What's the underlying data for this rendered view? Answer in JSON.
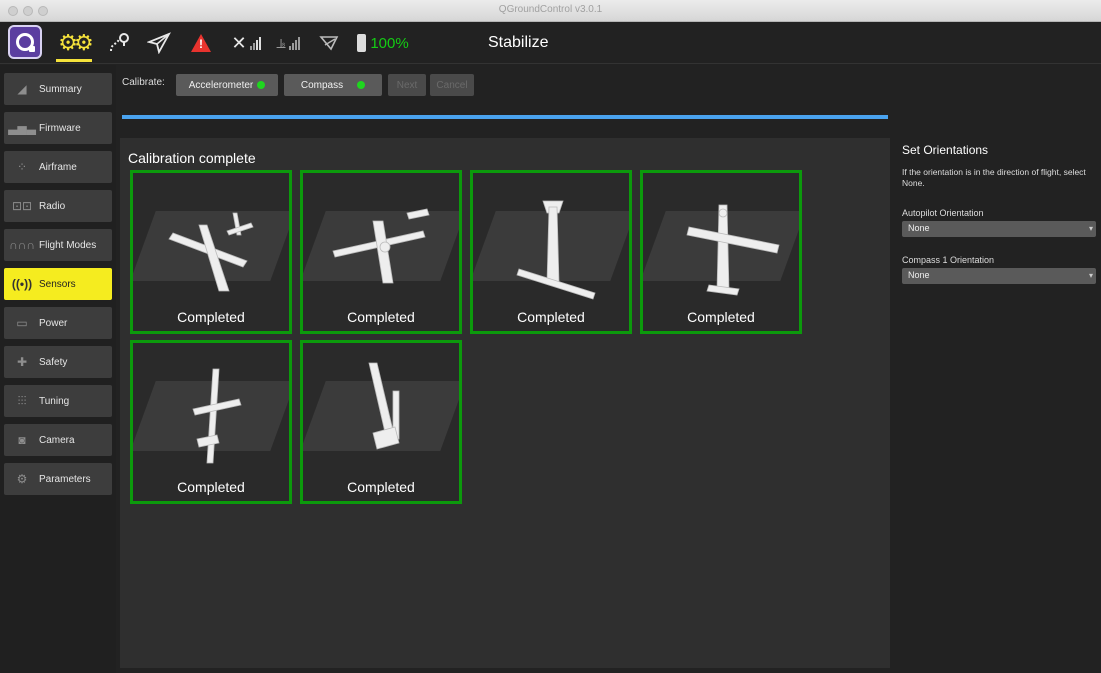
{
  "window": {
    "title": "QGroundControl v3.0.1"
  },
  "toolbar": {
    "battery_percent": "100%",
    "flight_mode": "Stabilize",
    "icons": [
      "app-logo-icon",
      "settings-gear-icon",
      "plan-route-icon",
      "fly-send-icon",
      "warning-icon",
      "gps-signal-icon",
      "rc-signal-icon",
      "telemetry-icon",
      "battery-icon"
    ],
    "colors": {
      "active": "#f5e23b",
      "battery": "#14cc14",
      "warning": "#e8332e"
    }
  },
  "sidebar": {
    "items": [
      {
        "label": "Summary",
        "icon": "paper-plane-icon"
      },
      {
        "label": "Firmware",
        "icon": "firmware-icon"
      },
      {
        "label": "Airframe",
        "icon": "airframe-icon"
      },
      {
        "label": "Radio",
        "icon": "radio-icon"
      },
      {
        "label": "Flight Modes",
        "icon": "flight-modes-icon"
      },
      {
        "label": "Sensors",
        "icon": "sensors-icon"
      },
      {
        "label": "Power",
        "icon": "power-icon"
      },
      {
        "label": "Safety",
        "icon": "safety-icon"
      },
      {
        "label": "Tuning",
        "icon": "tuning-icon"
      },
      {
        "label": "Camera",
        "icon": "camera-icon"
      },
      {
        "label": "Parameters",
        "icon": "parameters-icon"
      }
    ],
    "active": "Sensors",
    "active_color": "#f5ec1f"
  },
  "calibrate": {
    "label": "Calibrate:",
    "buttons": [
      {
        "label": "Accelerometer",
        "status": "ok"
      },
      {
        "label": "Compass",
        "status": "ok"
      },
      {
        "label": "Next",
        "enabled": false
      },
      {
        "label": "Cancel",
        "enabled": false
      }
    ],
    "progress": 1.0,
    "progress_color": "#4aa3ef"
  },
  "main": {
    "status": "Calibration complete",
    "orientations": [
      {
        "label": "Completed",
        "pose": "level"
      },
      {
        "label": "Completed",
        "pose": "upside-down"
      },
      {
        "label": "Completed",
        "pose": "nose-down"
      },
      {
        "label": "Completed",
        "pose": "nose-up"
      },
      {
        "label": "Completed",
        "pose": "left-side"
      },
      {
        "label": "Completed",
        "pose": "right-side"
      }
    ],
    "complete_color": "#0c9a0c"
  },
  "right_panel": {
    "title": "Set Orientations",
    "description": "If the orientation is in the direction of flight, select None.",
    "autopilot_label": "Autopilot Orientation",
    "autopilot_value": "None",
    "compass_label": "Compass 1 Orientation",
    "compass_value": "None"
  }
}
